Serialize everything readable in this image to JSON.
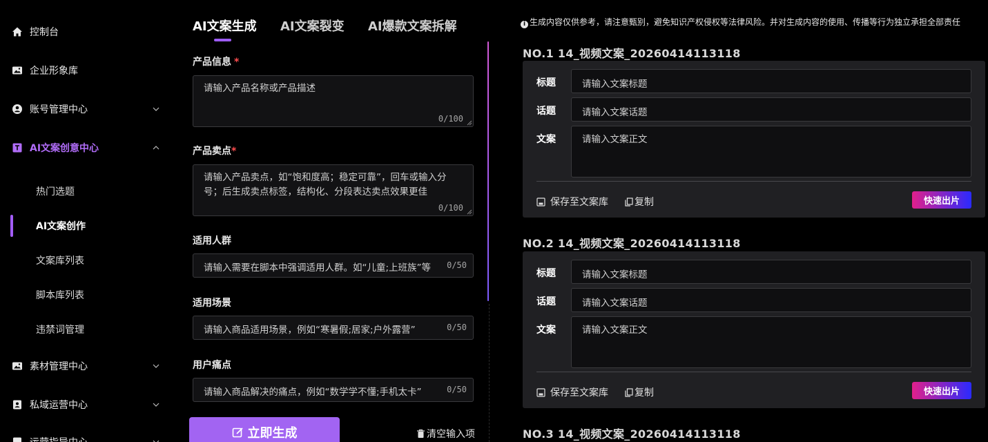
{
  "sidebar": {
    "items": [
      {
        "label": "控制台",
        "icon": "home-icon"
      },
      {
        "label": "企业形象库",
        "icon": "image-folder-icon"
      },
      {
        "label": "账号管理中心",
        "icon": "user-circle-icon"
      },
      {
        "label": "AI文案创意中心",
        "icon": "text-box-icon"
      },
      {
        "label": "素材管理中心",
        "icon": "image-folder-icon"
      },
      {
        "label": "私域运营中心",
        "icon": "contact-book-icon"
      },
      {
        "label": "运营指导中心",
        "icon": "guide-icon"
      }
    ],
    "sub_items": [
      {
        "label": "热门选题"
      },
      {
        "label": "AI文案创作"
      },
      {
        "label": "文案库列表"
      },
      {
        "label": "脚本库列表"
      },
      {
        "label": "违禁词管理"
      }
    ]
  },
  "tabs": [
    {
      "label": "AI文案生成"
    },
    {
      "label": "AI文案裂变"
    },
    {
      "label": "AI爆款文案拆解"
    }
  ],
  "form": {
    "product_info": {
      "label": "产品信息",
      "required": "*",
      "placeholder": "请输入产品名称或产品描述",
      "count": "0/100"
    },
    "selling_points": {
      "label": "产品卖点",
      "required": "*",
      "placeholder": "请输入产品卖点，如“饱和度高；稳定可靠”，回车或输入分号；后生成卖点标签，结构化、分段表达卖点效果更佳",
      "count": "0/100"
    },
    "audience": {
      "label": "适用人群",
      "placeholder": "请输入需要在脚本中强调适用人群。如“儿童;上班族”等",
      "count": "0/50"
    },
    "scenario": {
      "label": "适用场景",
      "placeholder": "请输入商品适用场景，例如“寒暑假;居家;户外露营”",
      "count": "0/50"
    },
    "pain_points": {
      "label": "用户痛点",
      "placeholder": "请输入商品解决的痛点，例如“数学学不懂;手机太卡”",
      "count": "0/50"
    },
    "generate_label": "立即生成",
    "clear_label": "清空输入项"
  },
  "results": {
    "notice": "生成内容仅供参考，请注意甄别，避免知识产权侵权等法律风险。并对生成内容的使用、传播等行为独立承担全部责任",
    "field_labels": {
      "title": "标题",
      "topic": "话题",
      "body": "文案"
    },
    "placeholders": {
      "title": "请输入文案标题",
      "topic": "请输入文案话题",
      "body": "请输入文案正文"
    },
    "save_label": "保存至文案库",
    "copy_label": "复制",
    "quick_label": "快速出片",
    "items": [
      {
        "title": "NO.1 14_视频文案_20260414113118"
      },
      {
        "title": "NO.2 14_视频文案_20260414113118"
      },
      {
        "title": "NO.3 14_视频文案_20260414113118"
      }
    ]
  },
  "colors": {
    "accent": "#a25cf6",
    "active_nav": "#b06cf7",
    "quick_start": "#e1208b",
    "quick_end": "#2a2aff",
    "required": "#ff4d4f"
  }
}
